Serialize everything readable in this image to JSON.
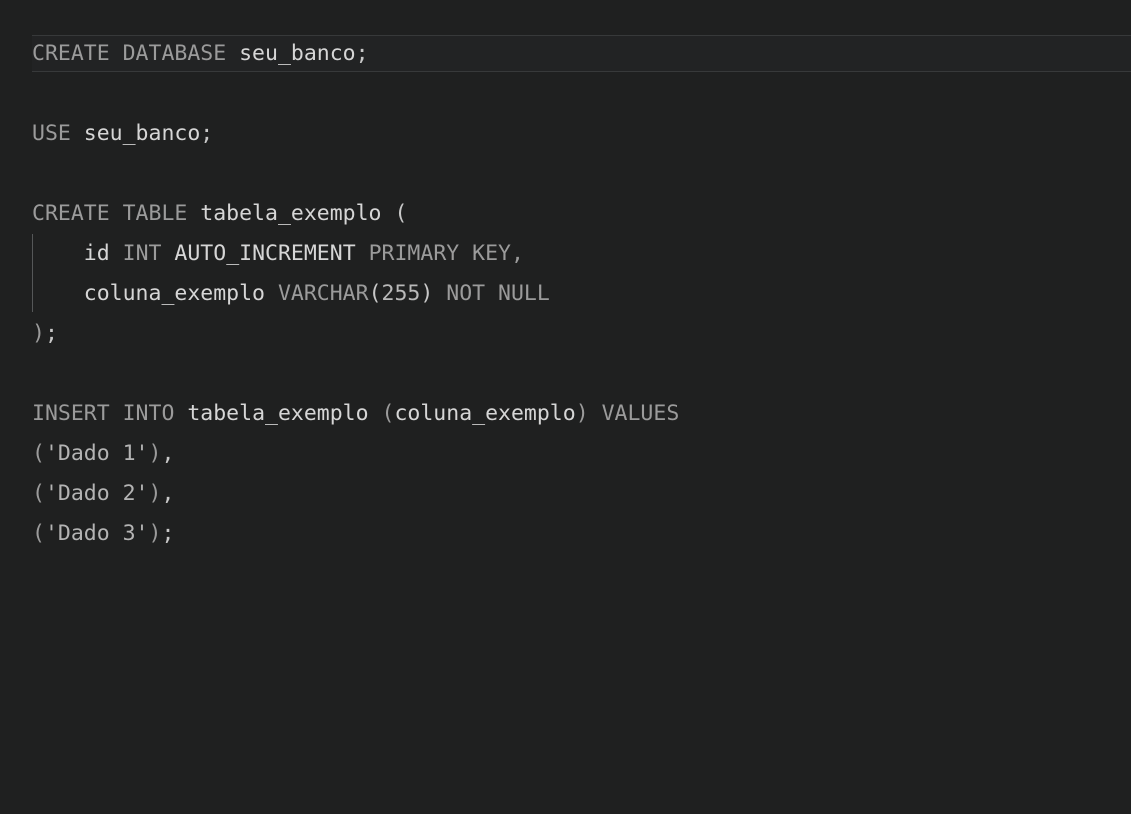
{
  "editor": {
    "background_color": "#1f2020",
    "current_line_highlight_color": "#222324",
    "current_line_border_color": "#37393a",
    "indent_guide_color": "#555758",
    "bright_text_color": "#d6d6d6",
    "dim_text_color": "#9b9b9b",
    "language": "SQL",
    "font_size_px": "21.5",
    "line_height_px": "40",
    "current_line_number": "1"
  },
  "code": {
    "lines": [
      {
        "number": "1",
        "text": "CREATE DATABASE seu_banco;",
        "highlighted": "true",
        "tokens": [
          {
            "text": "CREATE DATABASE ",
            "kind": "keyword"
          },
          {
            "text": "seu_banco",
            "kind": "identifier"
          },
          {
            "text": ";",
            "kind": "punct"
          }
        ]
      },
      {
        "number": "2",
        "text": "",
        "highlighted": "false",
        "tokens": []
      },
      {
        "number": "3",
        "text": "USE seu_banco;",
        "highlighted": "false",
        "tokens": [
          {
            "text": "USE ",
            "kind": "keyword"
          },
          {
            "text": "seu_banco",
            "kind": "identifier"
          },
          {
            "text": ";",
            "kind": "punct"
          }
        ]
      },
      {
        "number": "4",
        "text": "",
        "highlighted": "false",
        "tokens": []
      },
      {
        "number": "5",
        "text": "CREATE TABLE tabela_exemplo (",
        "highlighted": "false",
        "tokens": [
          {
            "text": "CREATE TABLE ",
            "kind": "keyword"
          },
          {
            "text": "tabela_exemplo",
            "kind": "identifier"
          },
          {
            "text": " ",
            "kind": "plain"
          },
          {
            "text": "(",
            "kind": "punct"
          }
        ]
      },
      {
        "number": "6",
        "text": "    id INT AUTO_INCREMENT PRIMARY KEY,",
        "highlighted": "false",
        "tokens": [
          {
            "text": "    ",
            "kind": "plain"
          },
          {
            "text": "id",
            "kind": "identifier"
          },
          {
            "text": " ",
            "kind": "plain"
          },
          {
            "text": "INT",
            "kind": "type"
          },
          {
            "text": " ",
            "kind": "plain"
          },
          {
            "text": "AUTO_INCREMENT",
            "kind": "modifier"
          },
          {
            "text": " ",
            "kind": "plain"
          },
          {
            "text": "PRIMARY KEY",
            "kind": "keyword"
          },
          {
            "text": ",",
            "kind": "punct-dim"
          }
        ]
      },
      {
        "number": "7",
        "text": "    coluna_exemplo VARCHAR(255) NOT NULL",
        "highlighted": "false",
        "tokens": [
          {
            "text": "    ",
            "kind": "plain"
          },
          {
            "text": "coluna_exemplo",
            "kind": "identifier"
          },
          {
            "text": " ",
            "kind": "plain"
          },
          {
            "text": "VARCHAR",
            "kind": "type"
          },
          {
            "text": "(",
            "kind": "punct"
          },
          {
            "text": "255",
            "kind": "number"
          },
          {
            "text": ")",
            "kind": "punct"
          },
          {
            "text": " ",
            "kind": "plain"
          },
          {
            "text": "NOT NULL",
            "kind": "keyword"
          }
        ]
      },
      {
        "number": "8",
        "text": ");",
        "highlighted": "false",
        "tokens": [
          {
            "text": ")",
            "kind": "punct-dim"
          },
          {
            "text": ";",
            "kind": "punct"
          }
        ]
      },
      {
        "number": "9",
        "text": "",
        "highlighted": "false",
        "tokens": []
      },
      {
        "number": "10",
        "text": "INSERT INTO tabela_exemplo (coluna_exemplo) VALUES",
        "highlighted": "false",
        "tokens": [
          {
            "text": "INSERT INTO ",
            "kind": "keyword"
          },
          {
            "text": "tabela_exemplo",
            "kind": "identifier"
          },
          {
            "text": " ",
            "kind": "plain"
          },
          {
            "text": "(",
            "kind": "punct-dim"
          },
          {
            "text": "coluna_exemplo",
            "kind": "identifier"
          },
          {
            "text": ")",
            "kind": "punct-dim"
          },
          {
            "text": " ",
            "kind": "plain"
          },
          {
            "text": "VALUES",
            "kind": "keyword"
          }
        ]
      },
      {
        "number": "11",
        "text": "('Dado 1'),",
        "highlighted": "false",
        "tokens": [
          {
            "text": "(",
            "kind": "punct-dim"
          },
          {
            "text": "'Dado 1'",
            "kind": "string"
          },
          {
            "text": ")",
            "kind": "punct-dim"
          },
          {
            "text": ",",
            "kind": "punct"
          }
        ]
      },
      {
        "number": "12",
        "text": "('Dado 2'),",
        "highlighted": "false",
        "tokens": [
          {
            "text": "(",
            "kind": "punct-dim"
          },
          {
            "text": "'Dado 2'",
            "kind": "string"
          },
          {
            "text": ")",
            "kind": "punct-dim"
          },
          {
            "text": ",",
            "kind": "punct"
          }
        ]
      },
      {
        "number": "13",
        "text": "('Dado 3');",
        "highlighted": "false",
        "tokens": [
          {
            "text": "(",
            "kind": "punct-dim"
          },
          {
            "text": "'Dado 3'",
            "kind": "string"
          },
          {
            "text": ")",
            "kind": "punct-dim"
          },
          {
            "text": ";",
            "kind": "punct"
          }
        ]
      }
    ],
    "indent_guides": [
      {
        "left_px": "32",
        "top_px": "234",
        "height_px": "78"
      }
    ]
  }
}
